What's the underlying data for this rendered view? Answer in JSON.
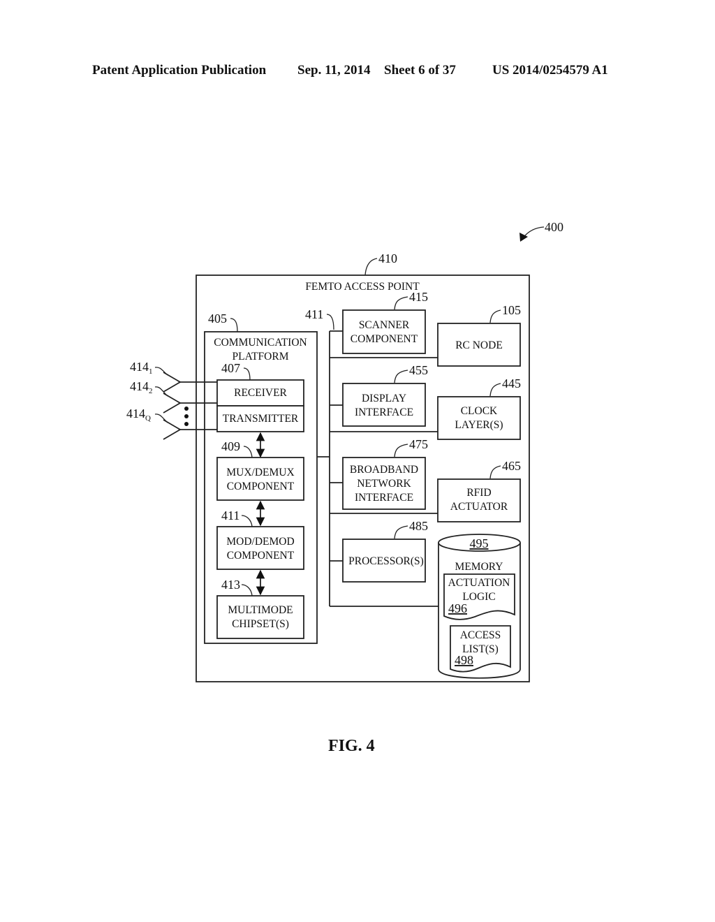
{
  "header": {
    "publication_type": "Patent Application Publication",
    "date": "Sep. 11, 2014",
    "sheet": "Sheet 6 of 37",
    "publication_number": "US 2014/0254579 A1"
  },
  "figure": {
    "caption": "FIG. 4",
    "ref_main": "400",
    "access_point": {
      "ref": "410",
      "title": "FEMTO ACCESS POINT",
      "bus_ref": "411"
    },
    "comm_platform": {
      "ref": "405",
      "title_line1": "COMMUNICATION",
      "title_line2": "PLATFORM",
      "receiver": {
        "ref": "407",
        "label": "RECEIVER"
      },
      "transmitter": {
        "label": "TRANSMITTER"
      },
      "mux": {
        "ref": "409",
        "line1": "MUX/DEMUX",
        "line2": "COMPONENT"
      },
      "mod": {
        "ref": "411",
        "line1": "MOD/DEMOD",
        "line2": "COMPONENT"
      },
      "chipset": {
        "ref": "413",
        "line1": "MULTIMODE",
        "line2": "CHIPSET(S)"
      }
    },
    "antennas": [
      {
        "ref": "414",
        "sub": "1"
      },
      {
        "ref": "414",
        "sub": "2"
      },
      {
        "ref": "414",
        "sub": "Q"
      }
    ],
    "scanner": {
      "ref": "415",
      "line1": "SCANNER",
      "line2": "COMPONENT"
    },
    "rc_node": {
      "ref": "105",
      "label": "RC NODE"
    },
    "display": {
      "ref": "455",
      "line1": "DISPLAY",
      "line2": "INTERFACE"
    },
    "clock": {
      "ref": "445",
      "line1": "CLOCK",
      "line2": "LAYER(S)"
    },
    "broadband": {
      "ref": "475",
      "line1": "BROADBAND",
      "line2": "NETWORK",
      "line3": "INTERFACE"
    },
    "rfid": {
      "ref": "465",
      "line1": "RFID",
      "line2": "ACTUATOR"
    },
    "processor": {
      "ref": "485",
      "label": "PROCESSOR(S)"
    },
    "memory": {
      "ref": "495",
      "label": "MEMORY",
      "actuation_logic": {
        "line1": "ACTUATION",
        "line2": "LOGIC",
        "ref": "496"
      },
      "access_list": {
        "line1": "ACCESS",
        "line2": "LIST(S)",
        "ref": "498"
      }
    }
  }
}
